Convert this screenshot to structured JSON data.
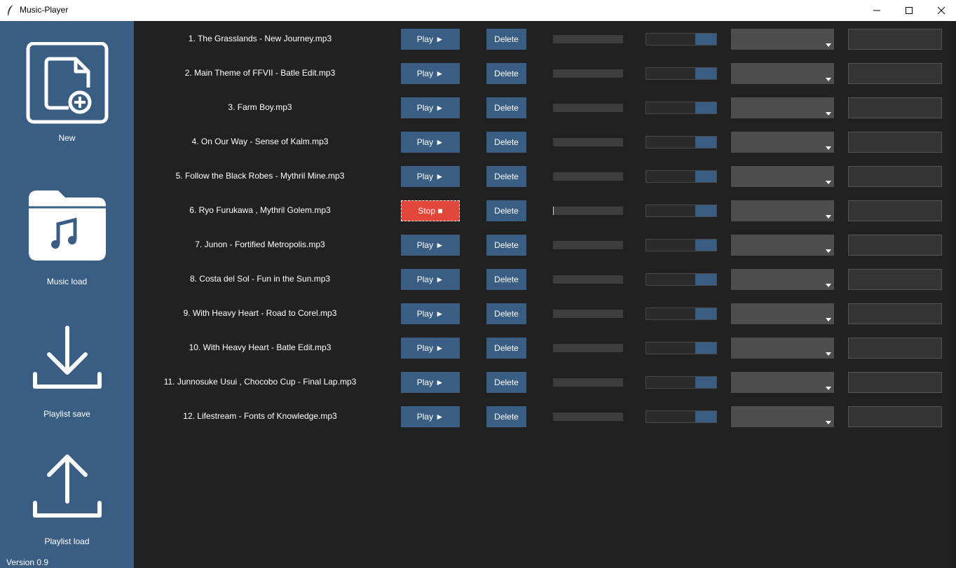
{
  "window": {
    "title": "Music-Player"
  },
  "sidebar": {
    "items": [
      {
        "label": "New",
        "icon": "new-file-icon"
      },
      {
        "label": "Music load",
        "icon": "music-folder-icon"
      },
      {
        "label": "Playlist save",
        "icon": "download-icon"
      },
      {
        "label": "Playlist load",
        "icon": "upload-icon"
      }
    ],
    "version": "Version 0.9"
  },
  "colors": {
    "accent": "#3a5d84",
    "stop": "#e0473a",
    "background": "#212121"
  },
  "tracks": [
    {
      "name": "1. The Grasslands - New Journey.mp3",
      "button": "Play ►",
      "delete": "Delete",
      "state": "stopped"
    },
    {
      "name": "2. Main Theme of FFVII - Batle Edit.mp3",
      "button": "Play ►",
      "delete": "Delete",
      "state": "stopped"
    },
    {
      "name": "3. Farm Boy.mp3",
      "button": "Play ►",
      "delete": "Delete",
      "state": "stopped"
    },
    {
      "name": "4. On Our Way - Sense of Kalm.mp3",
      "button": "Play ►",
      "delete": "Delete",
      "state": "stopped"
    },
    {
      "name": "5. Follow the Black Robes - Mythril Mine.mp3",
      "button": "Play ►",
      "delete": "Delete",
      "state": "stopped"
    },
    {
      "name": "6. Ryo Furukawa , Mythril Golem.mp3",
      "button": "Stop ■",
      "delete": "Delete",
      "state": "playing"
    },
    {
      "name": "7. Junon - Fortified Metropolis.mp3",
      "button": "Play ►",
      "delete": "Delete",
      "state": "stopped"
    },
    {
      "name": "8. Costa del Sol - Fun in the Sun.mp3",
      "button": "Play ►",
      "delete": "Delete",
      "state": "stopped"
    },
    {
      "name": "9. With Heavy Heart - Road to Corel.mp3",
      "button": "Play ►",
      "delete": "Delete",
      "state": "stopped"
    },
    {
      "name": "10. With Heavy Heart - Batle Edit.mp3",
      "button": "Play ►",
      "delete": "Delete",
      "state": "stopped"
    },
    {
      "name": "11. Junnosuke Usui , Chocobo Cup - Final Lap.mp3",
      "button": "Play ►",
      "delete": "Delete",
      "state": "stopped"
    },
    {
      "name": "12. Lifestream - Fonts of Knowledge.mp3",
      "button": "Play ►",
      "delete": "Delete",
      "state": "stopped"
    }
  ]
}
